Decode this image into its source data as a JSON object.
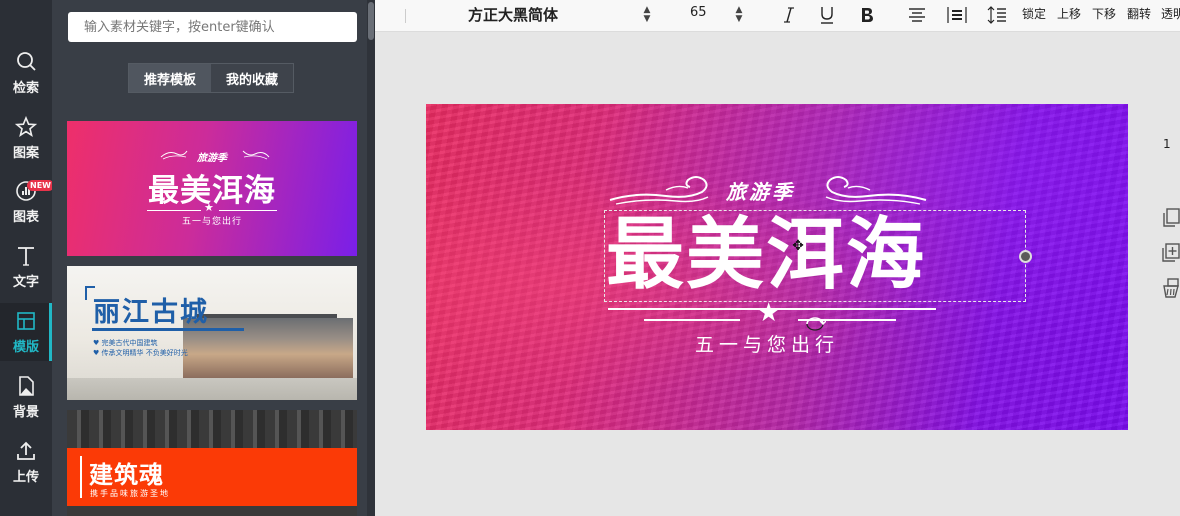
{
  "rail": [
    {
      "label": "检索",
      "icon": "search-icon"
    },
    {
      "label": "图案",
      "icon": "star-outline-icon"
    },
    {
      "label": "图表",
      "icon": "chart-icon",
      "badge": "NEW"
    },
    {
      "label": "文字",
      "icon": "text-icon"
    },
    {
      "label": "模版",
      "icon": "template-icon",
      "active": true
    },
    {
      "label": "背景",
      "icon": "background-icon"
    },
    {
      "label": "上传",
      "icon": "upload-icon"
    }
  ],
  "panel": {
    "search_placeholder": "输入素材关键字，按enter键确认",
    "tabs": [
      {
        "label": "推荐模板",
        "active": true
      },
      {
        "label": "我的收藏",
        "active": false
      }
    ],
    "templates": [
      {
        "subtitle": "旅游季",
        "title": "最美洱海",
        "tagline": "五一与您出行"
      },
      {
        "title": "丽江古城",
        "lines": [
          "♥ 完美古代中国建筑",
          "♥ 传承文明精华 不负美好时光"
        ]
      },
      {
        "title": "建筑魂",
        "subtitle": "携手品味旅游圣地"
      }
    ]
  },
  "toolbar": {
    "font": "方正大黑简体",
    "size": "65",
    "lock": "锁定",
    "move_up": "上移",
    "move_down": "下移",
    "flip": "翻转",
    "opacity": "透明"
  },
  "canvas": {
    "subtitle": "旅游季",
    "title": "最美洱海",
    "tagline": "五一与您出行",
    "gradient_start": "#ea2c62",
    "gradient_end": "#7b0cf0"
  },
  "page_number": "1",
  "colors": {
    "accent": "#21b8c6",
    "rail_bg": "#2b2f36",
    "panel_bg": "#393e46",
    "badge": "#e8334a"
  }
}
